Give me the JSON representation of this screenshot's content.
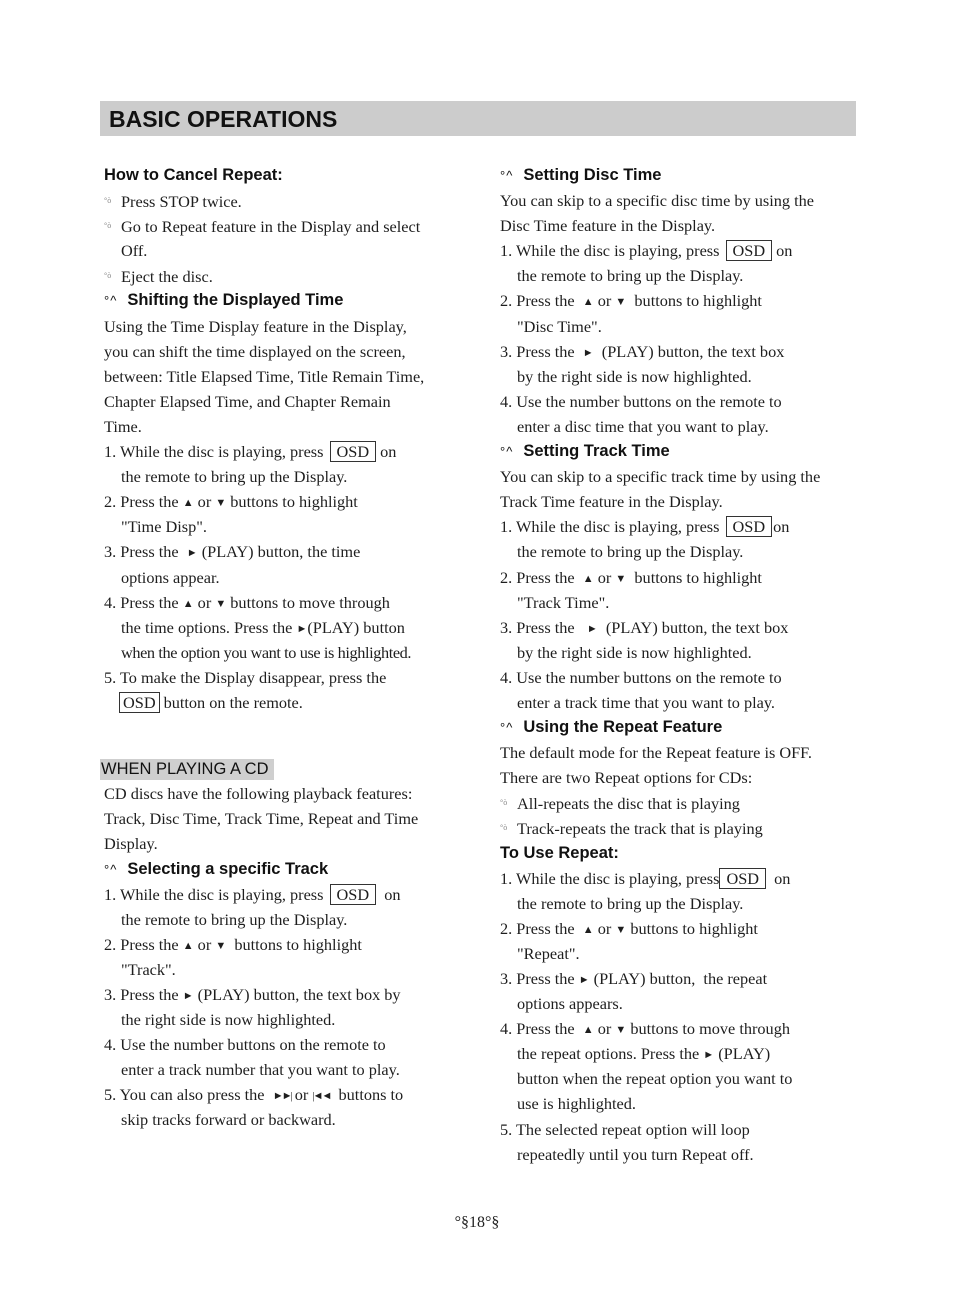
{
  "header": {
    "title": "BASIC OPERATIONS"
  },
  "osd_label": "OSD",
  "symbols": {
    "heading_mark": "°^",
    "bullet": "°ò",
    "up": "▲",
    "down": "▼",
    "play": "►",
    "next": "►►|",
    "prev": "|◄◄"
  },
  "left": {
    "cancel_repeat": {
      "heading": "How to Cancel Repeat:",
      "bullets": [
        "Press STOP twice.",
        "Go to Repeat feature in the Display and select",
        "Off.",
        "Eject the disc."
      ]
    },
    "shift_time": {
      "heading": "Shifting the Displayed Time",
      "intro": [
        "Using the Time Display feature in the Display,",
        "you can shift the time displayed on the screen,",
        "between: Title Elapsed Time, Title Remain Time,",
        "Chapter Elapsed Time, and Chapter Remain",
        "Time."
      ],
      "s1a": "1. While the disc is playing, press",
      "s1b": "on",
      "s1c": "the remote to bring up the Display.",
      "s2a": "2. Press the",
      "s2b": "or",
      "s2c": "buttons to highlight",
      "s2d": "\"Time Disp\".",
      "s3a": "3. Press the",
      "s3b": "(PLAY) button, the time",
      "s3c": "options appear.",
      "s4a": "4. Press the",
      "s4b": "or",
      "s4c": "buttons to move through",
      "s4d": "the time options. Press the",
      "s4e": "(PLAY) button",
      "s4f": "when the option you want to use is highlighted.",
      "s5a": "5. To make the Display disappear, press the",
      "s5b": "button on the remote."
    },
    "cd_section": {
      "tag": "WHEN PLAYING A CD",
      "intro": [
        "CD discs have the following playback features:",
        "Track, Disc Time, Track Time, Repeat and Time",
        "Display."
      ]
    },
    "select_track": {
      "heading": "Selecting a specific Track",
      "s1a": "1. While the disc is playing, press",
      "s1b": "on",
      "s1c": "the remote to bring up the Display.",
      "s2a": "2. Press the",
      "s2b": "or",
      "s2c": "buttons to highlight",
      "s2d": "\"Track\".",
      "s3a": "3. Press the",
      "s3b": "(PLAY) button, the text box by",
      "s3c": "the right side is now highlighted.",
      "s4a": "4. Use the number buttons on the remote to",
      "s4b": "enter a track number that you want to play.",
      "s5a": "5. You can also press the",
      "s5b": "or",
      "s5c": "buttons to",
      "s5d": "skip tracks forward or backward."
    }
  },
  "right": {
    "disc_time": {
      "heading": "Setting Disc Time",
      "intro": [
        "You can skip to a specific disc time by using the",
        "Disc Time feature in the Display."
      ],
      "s1a": "1. While the disc is playing, press",
      "s1b": "on",
      "s1c": "the remote to bring up the Display.",
      "s2a": "2. Press the",
      "s2b": "or",
      "s2c": "buttons to highlight",
      "s2d": "\"Disc Time\".",
      "s3a": "3. Press the",
      "s3b": "(PLAY) button, the text box",
      "s3c": "by the right side is now highlighted.",
      "s4a": "4. Use the number buttons on the remote to",
      "s4b": "enter a disc time that you want to play."
    },
    "track_time": {
      "heading": "Setting Track Time",
      "intro": [
        "You can skip to a specific track time by using the",
        "Track Time feature in the Display."
      ],
      "s1a": "1. While the disc is playing, press",
      "s1b": "on",
      "s1c": "the remote to bring up the Display.",
      "s2a": "2. Press the",
      "s2b": "or",
      "s2c": "buttons to highlight",
      "s2d": "\"Track Time\".",
      "s3a": "3. Press the",
      "s3b": "(PLAY) button, the text box",
      "s3c": "by the right side is now highlighted.",
      "s4a": "4. Use the number buttons on the remote to",
      "s4b": "enter a track time that you want to play."
    },
    "repeat_feature": {
      "heading": "Using the Repeat Feature",
      "intro": [
        "The default mode for the Repeat feature is OFF.",
        "There are two Repeat options for CDs:"
      ],
      "bullets": [
        "All-repeats the disc that is playing",
        "Track-repeats the track that is playing"
      ]
    },
    "use_repeat": {
      "heading": "To Use Repeat:",
      "s1a": "1. While the disc is playing, press",
      "s1b": "on",
      "s1c": "the remote to bring up the Display.",
      "s2a": "2. Press the",
      "s2b": "or",
      "s2c": "buttons to highlight",
      "s2d": "\"Repeat\".",
      "s3a": "3. Press the",
      "s3b": "(PLAY) button,  the repeat",
      "s3c": "options appears.",
      "s4a": "4. Press the",
      "s4b": "or",
      "s4c": "buttons to move through",
      "s4d": "the repeat options. Press the",
      "s4e": "(PLAY)",
      "s4f": "button when the repeat option you want to",
      "s4g": "use is highlighted.",
      "s5a": "5. The selected repeat option will loop",
      "s5b": "repeatedly until you turn Repeat off."
    }
  },
  "footer": {
    "page_number": "°§18°§"
  }
}
